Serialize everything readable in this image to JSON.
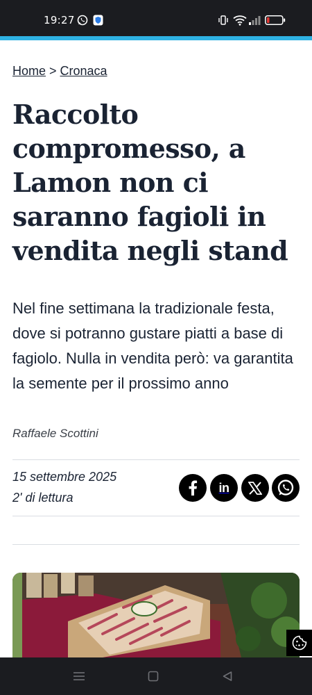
{
  "status_bar": {
    "time": "19:27",
    "icons": [
      "whatsapp-icon",
      "shield-icon",
      "vibrate-icon",
      "wifi-icon",
      "signal-icon",
      "battery-low-icon"
    ]
  },
  "colors": {
    "accent": "#2fb2e3",
    "text": "#1a2333",
    "battery_warning": "#e53935"
  },
  "breadcrumb": {
    "home": "Home",
    "separator": ">",
    "section": "Cronaca"
  },
  "article": {
    "headline": "Raccolto compromesso, a Lamon non ci saranno fagioli in vendita negli stand",
    "subtitle": "Nel fine settimana la tradizionale festa, dove si potranno gustare piatti a base di fagiolo. Nulla in vendita però: va garantita la semente per il prossimo anno",
    "author": "Raffaele Scottini",
    "date": "15 settembre 2025",
    "reading_time": "2' di lettura"
  },
  "share": {
    "buttons": [
      "facebook-icon",
      "linkedin-icon",
      "x-icon",
      "whatsapp-icon"
    ],
    "linkedin_glyph": "in"
  },
  "cookie_button_icon": "cookie-icon",
  "nav_bar": {
    "buttons": [
      "menu-icon",
      "home-icon",
      "back-icon"
    ]
  }
}
